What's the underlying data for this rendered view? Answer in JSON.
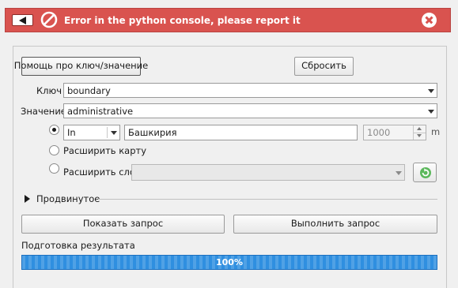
{
  "error_banner": {
    "message": "Error in the python console, please report it",
    "color": "#d9534f",
    "icons": [
      "back-arrow-icon",
      "prohibited-icon",
      "close-icon"
    ]
  },
  "toolbar": {
    "help_button": "Помощь про ключ/значение",
    "reset_button": "Сбросить"
  },
  "key": {
    "label": "Ключ",
    "value": "boundary"
  },
  "value": {
    "label": "Значение",
    "value": "administrative"
  },
  "location": {
    "mode_value": "In",
    "place_value": "Башкирия",
    "distance_value": "1000",
    "distance_unit": "m",
    "extend_map_label": "Расширить карту",
    "extend_layer_label": "Расширить слой",
    "layer_value": ""
  },
  "advanced": {
    "label": "Продвинутое"
  },
  "actions": {
    "show_query_button": "Показать запрос",
    "run_query_button": "Выполнить запрос"
  },
  "progress": {
    "label": "Подготовка результата",
    "text": "100%",
    "value": 1.0,
    "color": "#2f8fe0"
  }
}
